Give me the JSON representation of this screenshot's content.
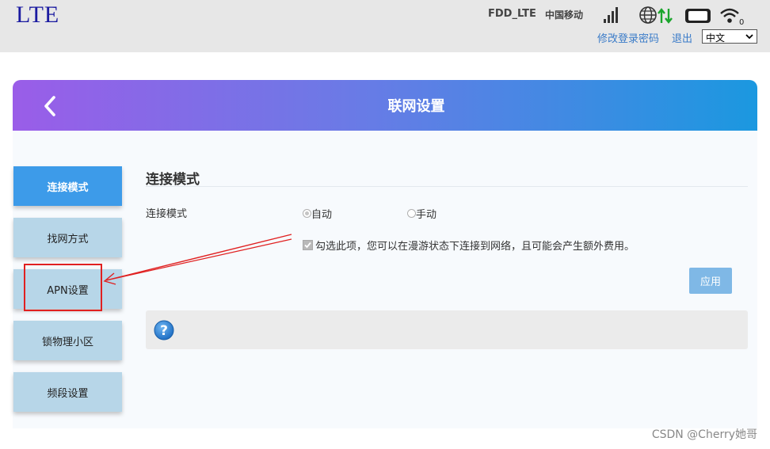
{
  "header": {
    "logo": "LTE",
    "network_type": "FDD_LTE",
    "carrier": "中国移动",
    "change_password": "修改登录密码",
    "logout": "退出",
    "language": "中文"
  },
  "status_icons": [
    "signal-icon",
    "globe-icon",
    "data-arrows-icon",
    "battery-icon",
    "wifi-icon"
  ],
  "panel": {
    "title": "联网设置",
    "back_icon": "chevron-left-icon"
  },
  "sidebar": {
    "items": [
      {
        "label": "连接模式",
        "active": true
      },
      {
        "label": "找网方式",
        "active": false
      },
      {
        "label": "APN设置",
        "active": false
      },
      {
        "label": "锁物理小区",
        "active": false
      },
      {
        "label": "频段设置",
        "active": false
      }
    ]
  },
  "content": {
    "section_title": "连接模式",
    "field_label": "连接模式",
    "options": [
      {
        "label": "自动",
        "checked": true
      },
      {
        "label": "手动",
        "checked": false
      }
    ],
    "roaming_checkbox": "勾选此项，您可以在漫游状态下连接到网络，且可能会产生额外费用。",
    "roaming_checked": true,
    "apply_label": "应用",
    "help_icon": "question-mark-icon"
  },
  "watermark": "CSDN @Cherry她哥",
  "colors": {
    "header_gradient_start": "#9a5de8",
    "header_gradient_end": "#1b98e0",
    "menu_active": "#3d9be9",
    "menu_inactive": "#b7d6e8",
    "annotation": "#e02020",
    "link": "#3a7bc8"
  }
}
